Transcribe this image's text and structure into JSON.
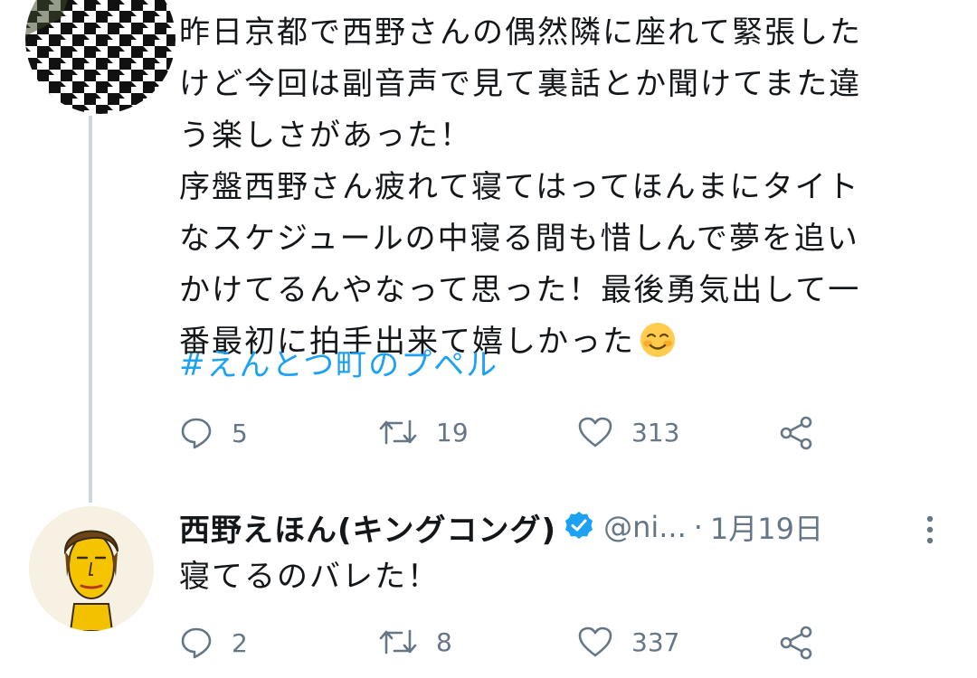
{
  "tweet1": {
    "author_name_cut": "",
    "author_handle_cut": "",
    "lines": [
      "昨日京都で西野さんの偶然隣に座れて緊張した",
      "けど今回は副音声で見て裏話とか聞けてまた違",
      "う楽しさがあった！",
      "序盤西野さん疲れて寝てはってほんまにタイト",
      "なスケジュールの中寝る間も惜しんで夢を追い",
      "かけてるんやなって思った！最後勇気出して一",
      "番最初に拍手出来て嬉しかった"
    ],
    "hashtag": "#えんとつ町のプペル",
    "emoji": "smiling-face-with-blush",
    "reply_count": "5",
    "retweet_count": "19",
    "like_count": "313"
  },
  "tweet2": {
    "author_name": "西野えほん(キングコング)",
    "handle": "@ni...",
    "separator": "·",
    "date": "1月19日",
    "text": "寝てるのバレた！",
    "reply_count": "2",
    "retweet_count": "8",
    "like_count": "337"
  },
  "colors": {
    "text": "#14171a",
    "muted": "#657786",
    "link": "#1da1f2",
    "verified": "#1da1f2",
    "thread_line": "#ccd6dd"
  },
  "icons": [
    "reply-icon",
    "retweet-icon",
    "like-icon",
    "share-icon",
    "verified-icon",
    "more-icon"
  ]
}
